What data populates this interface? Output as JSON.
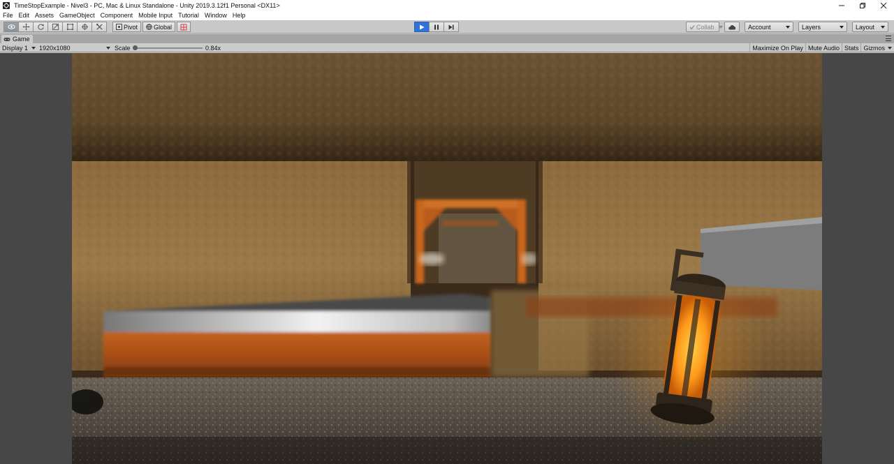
{
  "window": {
    "title": "TimeStopExample - Nivel3 - PC, Mac & Linux Standalone - Unity 2019.3.12f1 Personal <DX11>"
  },
  "menu": [
    "File",
    "Edit",
    "Assets",
    "GameObject",
    "Component",
    "Mobile Input",
    "Tutorial",
    "Window",
    "Help"
  ],
  "toolbar": {
    "tools": [
      "hand-tool",
      "move-tool",
      "rotate-tool",
      "scale-tool",
      "rect-tool",
      "transform-tool",
      "custom-tool"
    ],
    "pivot_label": "Pivot",
    "global_label": "Global",
    "collab_label": "Collab",
    "account_label": "Account",
    "layers_label": "Layers",
    "layout_label": "Layout"
  },
  "game_view": {
    "tab_label": "Game",
    "display": "Display 1",
    "resolution": "1920x1080",
    "scale_label": "Scale",
    "scale_value": "0.84x",
    "maximize_label": "Maximize On Play",
    "mute_label": "Mute Audio",
    "stats_label": "Stats",
    "gizmos_label": "Gizmos"
  },
  "colors": {
    "play_active": "#2f73d8",
    "lantern_glow": "#ff9a1a",
    "stone": "#8a6a3e"
  }
}
